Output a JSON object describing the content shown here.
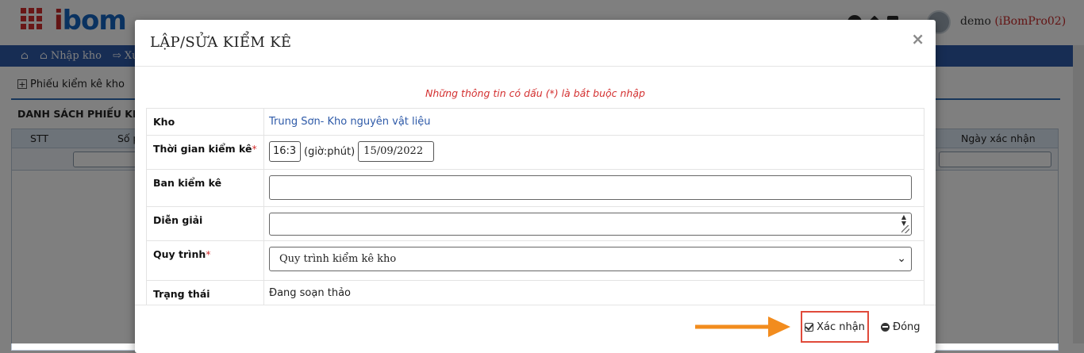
{
  "app": {
    "logo_text_i": "i",
    "logo_text_rest": "bom",
    "user_name": "demo",
    "user_account": "(iBomPro02)",
    "nav": [
      {
        "label": ""
      },
      {
        "label": "Nhập kho"
      },
      {
        "label": "Xu"
      }
    ],
    "toolbar_action": "Phiếu kiểm kê kho",
    "list_title": "DANH SÁCH PHIẾU KIỂM",
    "table_headers": {
      "stt": "STT",
      "so": "Số p",
      "ngay_xac_nhan": "Ngày xác nhận"
    }
  },
  "modal": {
    "title": "LẬP/SỬA KIỂM KÊ",
    "close_symbol": "×",
    "required_note": "Những thông tin có dấu (*) là bắt buộc nhập",
    "fields": {
      "kho": {
        "label": "Kho",
        "value": "Trung Sơn- Kho nguyên vật liệu"
      },
      "thoi_gian": {
        "label": "Thời gian kiểm kê",
        "required_mark": "*",
        "time": "16:3",
        "time_unit": "(giờ:phút)",
        "date": "15/09/2022"
      },
      "ban_kiem_ke": {
        "label": "Ban kiểm kê",
        "value": ""
      },
      "dien_giai": {
        "label": "Diễn giải",
        "value": ""
      },
      "quy_trinh": {
        "label": "Quy trình",
        "required_mark": "*",
        "selected": "Quy trình kiểm kê kho"
      },
      "trang_thai": {
        "label": "Trạng thái",
        "value": "Đang soạn thảo"
      }
    },
    "buttons": {
      "confirm": "Xác nhận",
      "close": "Đóng"
    }
  },
  "colors": {
    "nav_bg": "#2e5aa8",
    "required": "#d32f2f",
    "highlight_box": "#e04a3a",
    "arrow": "#f28c1e"
  }
}
